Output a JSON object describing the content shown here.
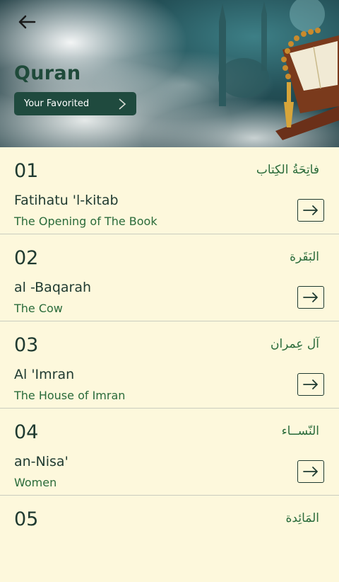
{
  "header": {
    "title": "Quran",
    "favorite_button": "Your Favorited"
  },
  "icons": {
    "back": "arrow-left-icon",
    "favorite_chevron": "chevron-right-icon",
    "open": "arrow-right-icon"
  },
  "colors": {
    "background": "#fdf8dc",
    "accent_green": "#2a6b3a",
    "button_dark_green": "#1f4a3e",
    "text_dark": "#1f3a30"
  },
  "surahs": [
    {
      "number": "01",
      "arabic": "فاتِحَةُ الكِتاب",
      "transliteration": "Fatihatu 'l-kitab",
      "meaning": "The Opening of The Book"
    },
    {
      "number": "02",
      "arabic": "البَقَرة",
      "transliteration": "al -Baqarah",
      "meaning": "The Cow"
    },
    {
      "number": "03",
      "arabic": "آل عِمران",
      "transliteration": "Al 'Imran",
      "meaning": "The House of Imran"
    },
    {
      "number": "04",
      "arabic": "النّســاء",
      "transliteration": "an-Nisa'",
      "meaning": "Women"
    },
    {
      "number": "05",
      "arabic": "المَائِدة",
      "transliteration": "",
      "meaning": ""
    }
  ]
}
